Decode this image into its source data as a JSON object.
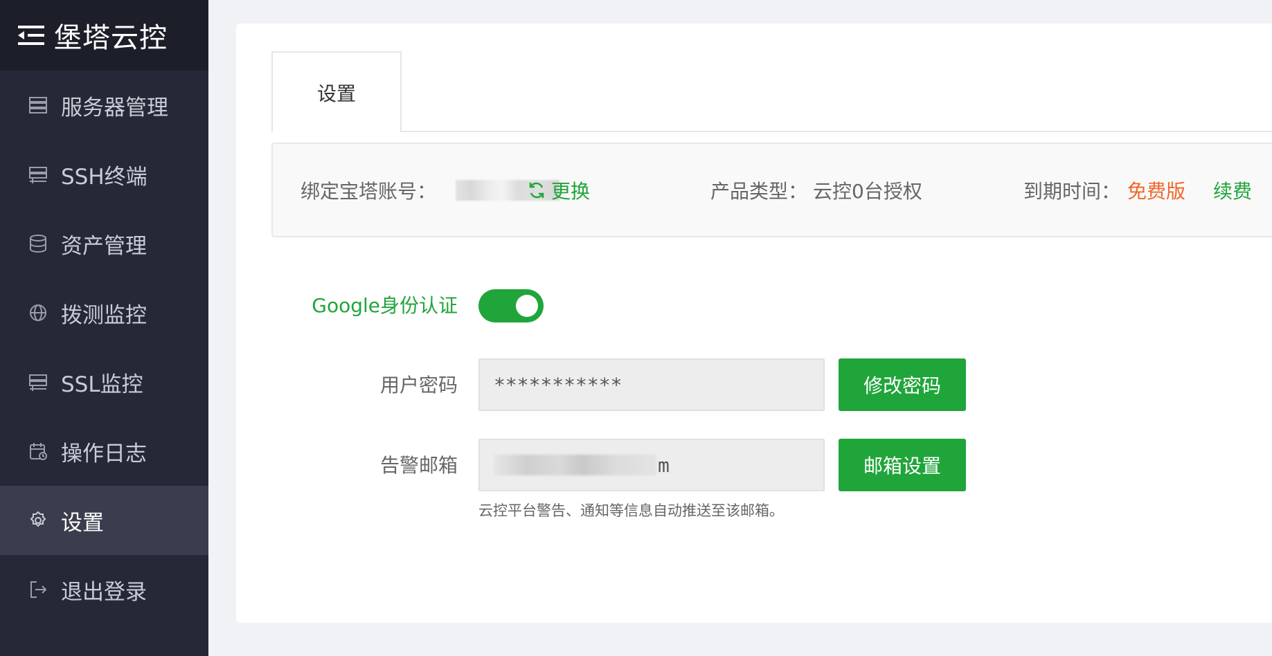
{
  "brand": {
    "title": "堡塔云控",
    "icon": "menu-fold-icon"
  },
  "sidebar": {
    "items": [
      {
        "label": "服务器管理",
        "icon": "server-icon",
        "active": false
      },
      {
        "label": "SSH终端",
        "icon": "terminal-icon",
        "active": false
      },
      {
        "label": "资产管理",
        "icon": "database-icon",
        "active": false
      },
      {
        "label": "拨测监控",
        "icon": "globe-icon",
        "active": false
      },
      {
        "label": "SSL监控",
        "icon": "ssl-server-icon",
        "active": false
      },
      {
        "label": "操作日志",
        "icon": "log-icon",
        "active": false
      },
      {
        "label": "设置",
        "icon": "gear-icon",
        "active": true
      },
      {
        "label": "退出登录",
        "icon": "logout-icon",
        "active": false
      }
    ]
  },
  "tabs": [
    {
      "label": "设置",
      "active": true
    }
  ],
  "info": {
    "account_label": "绑定宝塔账号：",
    "swap_label": "更换",
    "product_label": "产品类型：",
    "product_value": "云控0台授权",
    "expire_label": "到期时间：",
    "expire_value": "免费版",
    "renew_label": "续费"
  },
  "form": {
    "google_auth_label": "Google身份认证",
    "google_auth_enabled": true,
    "password_label": "用户密码",
    "password_value": "***********",
    "change_password_label": "修改密码",
    "email_label": "告警邮箱",
    "email_value_tail": "m",
    "email_settings_label": "邮箱设置",
    "email_hint": "云控平台警告、通知等信息自动推送至该邮箱。"
  },
  "colors": {
    "accent_green": "#20a53a",
    "expire_orange": "#f0652c",
    "sidebar_bg": "#252836",
    "sidebar_active": "#3a3d4d"
  }
}
